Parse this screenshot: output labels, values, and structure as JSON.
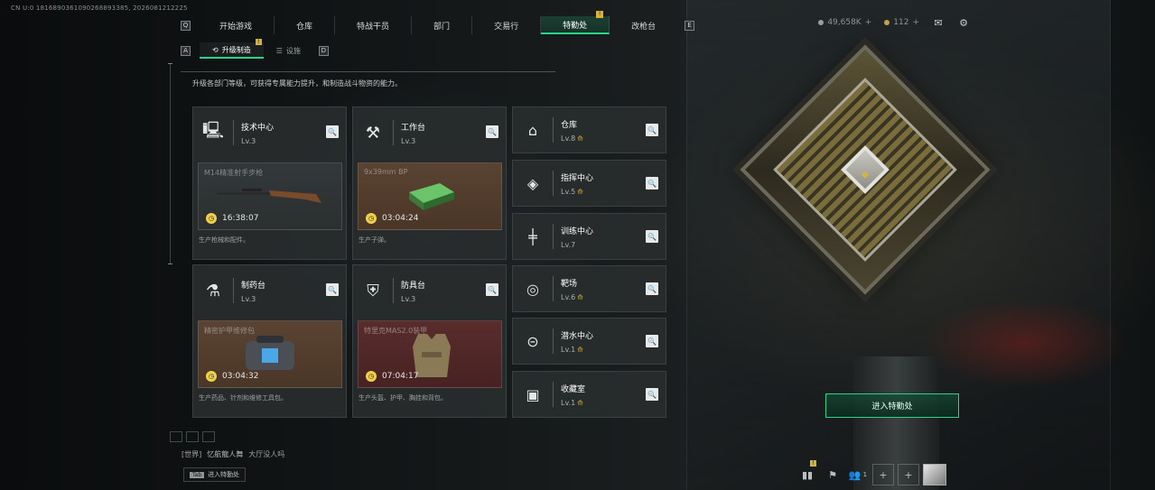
{
  "debug": "CN U:0 1816890361090268893385, 2026081212225",
  "nav": {
    "left_key": "Q",
    "right_key": "E",
    "tabs": [
      {
        "label": "开始游戏"
      },
      {
        "label": "仓库"
      },
      {
        "label": "特战干员"
      },
      {
        "label": "部门"
      },
      {
        "label": "交易行"
      },
      {
        "label": "特勤处",
        "active": true,
        "badge": "!"
      },
      {
        "label": "改枪台"
      }
    ]
  },
  "currency": {
    "silver": "49,658K",
    "gold": "112"
  },
  "subnav": {
    "left_key": "A",
    "right_key": "D",
    "tabs": [
      {
        "label": "升级制造",
        "active": true,
        "badge": "!"
      },
      {
        "label": "设施"
      }
    ]
  },
  "description": "升级各部门等级，可获得专属能力提升，和制造战斗物资的能力。",
  "workshops": [
    {
      "title": "技术中心",
      "level": "Lv.3",
      "product": "M14精准射手步枪",
      "time": "16:38:07",
      "footer": "生产枪械和配件。",
      "icon": "computer-icon",
      "tone": "gray"
    },
    {
      "title": "工作台",
      "level": "Lv.3",
      "product": "9x39mm BP",
      "time": "03:04:24",
      "footer": "生产子弹。",
      "icon": "tools-icon",
      "tone": "brown"
    },
    {
      "title": "制药台",
      "level": "Lv.3",
      "product": "精密护甲维修包",
      "time": "03:04:32",
      "footer": "生产药品、针剂和维修工具包。",
      "icon": "pharma-icon",
      "tone": "brown"
    },
    {
      "title": "防具台",
      "level": "Lv.3",
      "product": "特里克MAS2.0装甲",
      "time": "07:04:17",
      "footer": "生产头盔、护甲、胸挂和背包。",
      "icon": "armor-icon",
      "tone": "red"
    }
  ],
  "facilities": [
    {
      "title": "仓库",
      "level": "Lv.8",
      "icon": "vault-icon",
      "star": true
    },
    {
      "title": "指挥中心",
      "level": "Lv.5",
      "icon": "command-icon",
      "star": true
    },
    {
      "title": "训练中心",
      "level": "Lv.7",
      "icon": "dumbbell-icon",
      "star": false
    },
    {
      "title": "靶场",
      "level": "Lv.6",
      "icon": "target-icon",
      "star": true
    },
    {
      "title": "潜水中心",
      "level": "Lv.1",
      "icon": "dive-icon",
      "star": true
    },
    {
      "title": "收藏室",
      "level": "Lv.1",
      "icon": "collection-icon",
      "star": true
    }
  ],
  "enter_button": "进入特勤处",
  "chat": {
    "channel": "[世界]",
    "name": "忆航龍人舞",
    "message": "大厅没人吗"
  },
  "tab_hint": {
    "key": "Tab",
    "label": "进入特勤处"
  },
  "bottom": {
    "stats_badge": "!",
    "friends_count": "1"
  },
  "colors": {
    "accent": "#2ad38a",
    "badge": "#d8b23b",
    "star": "#c9a23c"
  }
}
